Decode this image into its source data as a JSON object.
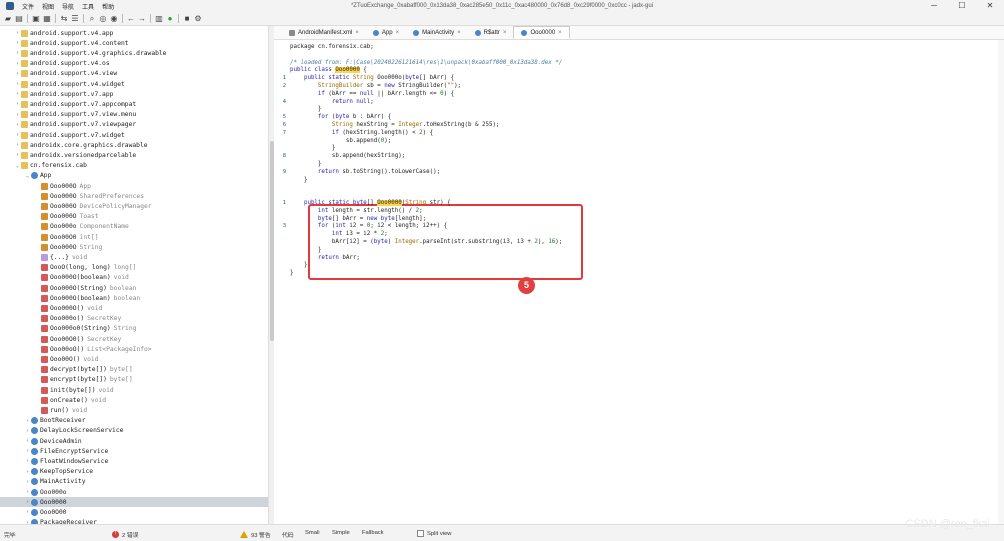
{
  "window": {
    "title": "*ZTuoExchange_0xabaff000_0x13da38_0xac285e50_0x11c_0xac480000_0x76d8_0xc29f0000_0xc0cc - jadx-gui",
    "controls": [
      "─",
      "☐",
      "✕"
    ]
  },
  "menu": [
    "文件",
    "视图",
    "导航",
    "工具",
    "帮助"
  ],
  "toolbar": [
    "folder-open-icon",
    "add-file-icon",
    "save-icon",
    "save-all-icon",
    "sync-tree-icon",
    "flatten-icon",
    "search-icon",
    "find-class-icon",
    "find-usage-icon",
    "back-icon",
    "forward-icon",
    "quark-icon",
    "deobf-icon",
    "log-icon",
    "settings-icon"
  ],
  "tree": [
    {
      "arrow": "›",
      "icon": "pkg",
      "name": "android.support.v4.app",
      "type": ""
    },
    {
      "arrow": "›",
      "icon": "pkg",
      "name": "android.support.v4.content",
      "type": ""
    },
    {
      "arrow": "›",
      "icon": "pkg",
      "name": "android.support.v4.graphics.drawable",
      "type": ""
    },
    {
      "arrow": "›",
      "icon": "pkg",
      "name": "android.support.v4.os",
      "type": ""
    },
    {
      "arrow": "›",
      "icon": "pkg",
      "name": "android.support.v4.view",
      "type": ""
    },
    {
      "arrow": "›",
      "icon": "pkg",
      "name": "android.support.v4.widget",
      "type": ""
    },
    {
      "arrow": "›",
      "icon": "pkg",
      "name": "android.support.v7.app",
      "type": ""
    },
    {
      "arrow": "›",
      "icon": "pkg",
      "name": "android.support.v7.appcompat",
      "type": ""
    },
    {
      "arrow": "›",
      "icon": "pkg",
      "name": "android.support.v7.view.menu",
      "type": ""
    },
    {
      "arrow": "›",
      "icon": "pkg",
      "name": "android.support.v7.viewpager",
      "type": ""
    },
    {
      "arrow": "›",
      "icon": "pkg",
      "name": "android.support.v7.widget",
      "type": ""
    },
    {
      "arrow": "›",
      "icon": "pkg",
      "name": "androidx.core.graphics.drawable",
      "type": ""
    },
    {
      "arrow": "›",
      "icon": "pkg",
      "name": "androidx.versionedparcelable",
      "type": ""
    },
    {
      "arrow": "⌄",
      "icon": "pkg",
      "name": "cn.forensix.cab",
      "type": ""
    },
    {
      "arrow": "⌄",
      "icon": "cls",
      "name": "App",
      "type": ""
    },
    {
      "arrow": "",
      "icon": "fld",
      "name": "Ooo000O",
      "type": "App"
    },
    {
      "arrow": "",
      "icon": "fld",
      "name": "Ooo000O",
      "type": "SharedPreferences"
    },
    {
      "arrow": "",
      "icon": "fld",
      "name": "Ooo000O",
      "type": "DevicePolicyManager"
    },
    {
      "arrow": "",
      "icon": "fld",
      "name": "Ooo000O",
      "type": "Toast"
    },
    {
      "arrow": "",
      "icon": "fld",
      "name": "Ooo000o",
      "type": "ComponentName"
    },
    {
      "arrow": "",
      "icon": "fld",
      "name": "Ooo00O0",
      "type": "int[]"
    },
    {
      "arrow": "",
      "icon": "fld",
      "name": "Ooo000O",
      "type": "String"
    },
    {
      "arrow": "",
      "icon": "blk",
      "name": "{...}",
      "type": "void"
    },
    {
      "arrow": "",
      "icon": "mth",
      "name": "OooO(long, long)",
      "type": "long[]"
    },
    {
      "arrow": "",
      "icon": "mth",
      "name": "Ooo000O(boolean)",
      "type": "void"
    },
    {
      "arrow": "",
      "icon": "mth",
      "name": "Ooo000O(String)",
      "type": "boolean"
    },
    {
      "arrow": "",
      "icon": "mth",
      "name": "Ooo000O(boolean)",
      "type": "boolean"
    },
    {
      "arrow": "",
      "icon": "mth",
      "name": "Ooo000O()",
      "type": "void"
    },
    {
      "arrow": "",
      "icon": "mth",
      "name": "Ooo000o()",
      "type": "SecretKey"
    },
    {
      "arrow": "",
      "icon": "mth",
      "name": "Ooo000o0(String)",
      "type": "String"
    },
    {
      "arrow": "",
      "icon": "mth",
      "name": "Ooo00O0()",
      "type": "SecretKey"
    },
    {
      "arrow": "",
      "icon": "mth",
      "name": "Ooo00oO()",
      "type": "List<PackageInfo>"
    },
    {
      "arrow": "",
      "icon": "mth",
      "name": "Ooo00O()",
      "type": "void"
    },
    {
      "arrow": "",
      "icon": "mth",
      "name": "decrypt(byte[])",
      "type": "byte[]"
    },
    {
      "arrow": "",
      "icon": "mth",
      "name": "encrypt(byte[])",
      "type": "byte[]"
    },
    {
      "arrow": "",
      "icon": "mth",
      "name": "init(byte[])",
      "type": "void"
    },
    {
      "arrow": "",
      "icon": "mth",
      "name": "onCreate()",
      "type": "void"
    },
    {
      "arrow": "",
      "icon": "mth",
      "name": "run()",
      "type": "void"
    },
    {
      "arrow": "›",
      "icon": "cls",
      "name": "BootReceiver",
      "type": ""
    },
    {
      "arrow": "›",
      "icon": "cls",
      "name": "DelayLockScreenService",
      "type": ""
    },
    {
      "arrow": "›",
      "icon": "cls",
      "name": "DeviceAdmin",
      "type": ""
    },
    {
      "arrow": "›",
      "icon": "cls",
      "name": "FileEncryptService",
      "type": ""
    },
    {
      "arrow": "›",
      "icon": "cls",
      "name": "FloatWindowService",
      "type": ""
    },
    {
      "arrow": "›",
      "icon": "cls",
      "name": "KeepTopService",
      "type": ""
    },
    {
      "arrow": "›",
      "icon": "cls",
      "name": "MainActivity",
      "type": ""
    },
    {
      "arrow": "›",
      "icon": "cls",
      "name": "Ooo000o",
      "type": ""
    },
    {
      "arrow": "›",
      "icon": "cls",
      "name": "Ooo0000",
      "type": ""
    },
    {
      "arrow": "›",
      "icon": "cls",
      "name": "Ooo0O00",
      "type": ""
    },
    {
      "arrow": "›",
      "icon": "cls",
      "name": "PackageReceiver",
      "type": ""
    }
  ],
  "tabs": [
    {
      "label": "AndroidManifest.xml",
      "icon": "xml"
    },
    {
      "label": "App",
      "icon": "cls"
    },
    {
      "label": "MainActivity",
      "icon": "cls"
    },
    {
      "label": "R$attr",
      "icon": "cls"
    },
    {
      "label": "Ooo0000",
      "icon": "cls"
    }
  ],
  "gutter": [
    {
      "num": "1",
      "line": 4
    },
    {
      "num": "2",
      "line": 5
    },
    {
      "num": "4",
      "line": 7
    },
    {
      "num": "5",
      "line": 9
    },
    {
      "num": "6",
      "line": 10
    },
    {
      "num": "7",
      "line": 11
    },
    {
      "num": "8",
      "line": 14
    },
    {
      "num": "9",
      "line": 16
    },
    {
      "num": "1",
      "line": 20
    },
    {
      "num": "3",
      "line": 23
    }
  ],
  "code": [
    {
      "t": [
        [
          "package cn.forensix.cab;",
          ""
        ]
      ]
    },
    {
      "t": []
    },
    {
      "t": [
        [
          "/* loaded from: F:\\Case\\20240226121614\\res\\1\\unpack\\0xabaff000_0x13da38.dex */",
          "cm"
        ]
      ]
    },
    {
      "t": [
        [
          "public class ",
          "kw"
        ],
        [
          "Ooo0000",
          "hl"
        ],
        [
          " {",
          ""
        ]
      ]
    },
    {
      "t": [
        [
          "    public static ",
          "kw"
        ],
        [
          "String ",
          "ty"
        ],
        [
          "Ooo000o(",
          ""
        ],
        [
          "byte",
          "kw"
        ],
        [
          "[] bArr) {",
          ""
        ]
      ]
    },
    {
      "t": [
        [
          "        StringBuilder ",
          "ty"
        ],
        [
          "sb = ",
          ""
        ],
        [
          "new ",
          "kw"
        ],
        [
          "StringBuilder(",
          ""
        ],
        [
          "\"\"",
          "st"
        ],
        [
          ");",
          ""
        ]
      ]
    },
    {
      "t": [
        [
          "        if ",
          "kw"
        ],
        [
          "(bArr == ",
          ""
        ],
        [
          "null",
          "kw"
        ],
        [
          " || bArr.length <= ",
          ""
        ],
        [
          "0",
          "nu"
        ],
        [
          ") {",
          ""
        ]
      ]
    },
    {
      "t": [
        [
          "            return null",
          "kw"
        ],
        [
          ";",
          ""
        ]
      ]
    },
    {
      "t": [
        [
          "        }",
          ""
        ]
      ]
    },
    {
      "t": [
        [
          "        for ",
          "kw"
        ],
        [
          "(",
          ""
        ],
        [
          "byte ",
          "kw"
        ],
        [
          "b : bArr) {",
          ""
        ]
      ]
    },
    {
      "t": [
        [
          "            String ",
          "ty"
        ],
        [
          "hexString = ",
          ""
        ],
        [
          "Integer",
          "ty"
        ],
        [
          ".toHexString(b & 255);",
          ""
        ]
      ]
    },
    {
      "t": [
        [
          "            if ",
          "kw"
        ],
        [
          "(hexString.length() < ",
          ""
        ],
        [
          "2",
          "nu"
        ],
        [
          ") {",
          ""
        ]
      ]
    },
    {
      "t": [
        [
          "                sb.append(",
          ""
        ],
        [
          "0",
          "nu"
        ],
        [
          ");",
          ""
        ]
      ]
    },
    {
      "t": [
        [
          "            }",
          ""
        ]
      ]
    },
    {
      "t": [
        [
          "            sb.append(hexString);",
          ""
        ]
      ]
    },
    {
      "t": [
        [
          "        }",
          ""
        ]
      ]
    },
    {
      "t": [
        [
          "        return ",
          "kw"
        ],
        [
          "sb.toString().toLowerCase();",
          ""
        ]
      ]
    },
    {
      "t": [
        [
          "    }",
          ""
        ]
      ]
    },
    {
      "t": []
    },
    {
      "t": []
    },
    {
      "t": [
        [
          "    public static ",
          "kw"
        ],
        [
          "byte",
          "kw"
        ],
        [
          "[] ",
          ""
        ],
        [
          "Ooo0000",
          "hl"
        ],
        [
          "(",
          ""
        ],
        [
          "String ",
          "ty"
        ],
        [
          "str) {",
          ""
        ]
      ]
    },
    {
      "t": [
        [
          "        int ",
          "kw"
        ],
        [
          "length = str.length() / ",
          ""
        ],
        [
          "2",
          "nu"
        ],
        [
          ";",
          ""
        ]
      ]
    },
    {
      "t": [
        [
          "        byte",
          "kw"
        ],
        [
          "[] bArr = ",
          ""
        ],
        [
          "new byte",
          "kw"
        ],
        [
          "[length];",
          ""
        ]
      ]
    },
    {
      "t": [
        [
          "        for ",
          "kw"
        ],
        [
          "(",
          ""
        ],
        [
          "int ",
          "kw"
        ],
        [
          "i2 = ",
          ""
        ],
        [
          "0",
          "nu"
        ],
        [
          "; i2 < length; i2++) {",
          ""
        ]
      ]
    },
    {
      "t": [
        [
          "            int ",
          "kw"
        ],
        [
          "i3 = i2 * ",
          ""
        ],
        [
          "2",
          "nu"
        ],
        [
          ";",
          ""
        ]
      ]
    },
    {
      "t": [
        [
          "            bArr[i2] = (",
          ""
        ],
        [
          "byte",
          "kw"
        ],
        [
          ") ",
          ""
        ],
        [
          "Integer",
          "ty"
        ],
        [
          ".parseInt(str.substring(i3, i3 + ",
          ""
        ],
        [
          "2",
          "nu"
        ],
        [
          "), ",
          ""
        ],
        [
          "16",
          "nu"
        ],
        [
          ");",
          ""
        ]
      ]
    },
    {
      "t": [
        [
          "        }",
          ""
        ]
      ]
    },
    {
      "t": [
        [
          "        return ",
          "kw"
        ],
        [
          "bArr;",
          ""
        ]
      ]
    },
    {
      "t": [
        [
          "    }",
          ""
        ]
      ]
    },
    {
      "t": [
        [
          "}",
          ""
        ]
      ]
    }
  ],
  "annotation": {
    "badge": "5"
  },
  "status": {
    "left": "完毕",
    "errors": "2 错误",
    "warnings": "93 警告",
    "view_modes": [
      "代码",
      "Smali",
      "Simple",
      "Fallback"
    ],
    "split_view": "Split view"
  },
  "watermark": "CSDN @ren_fkai"
}
